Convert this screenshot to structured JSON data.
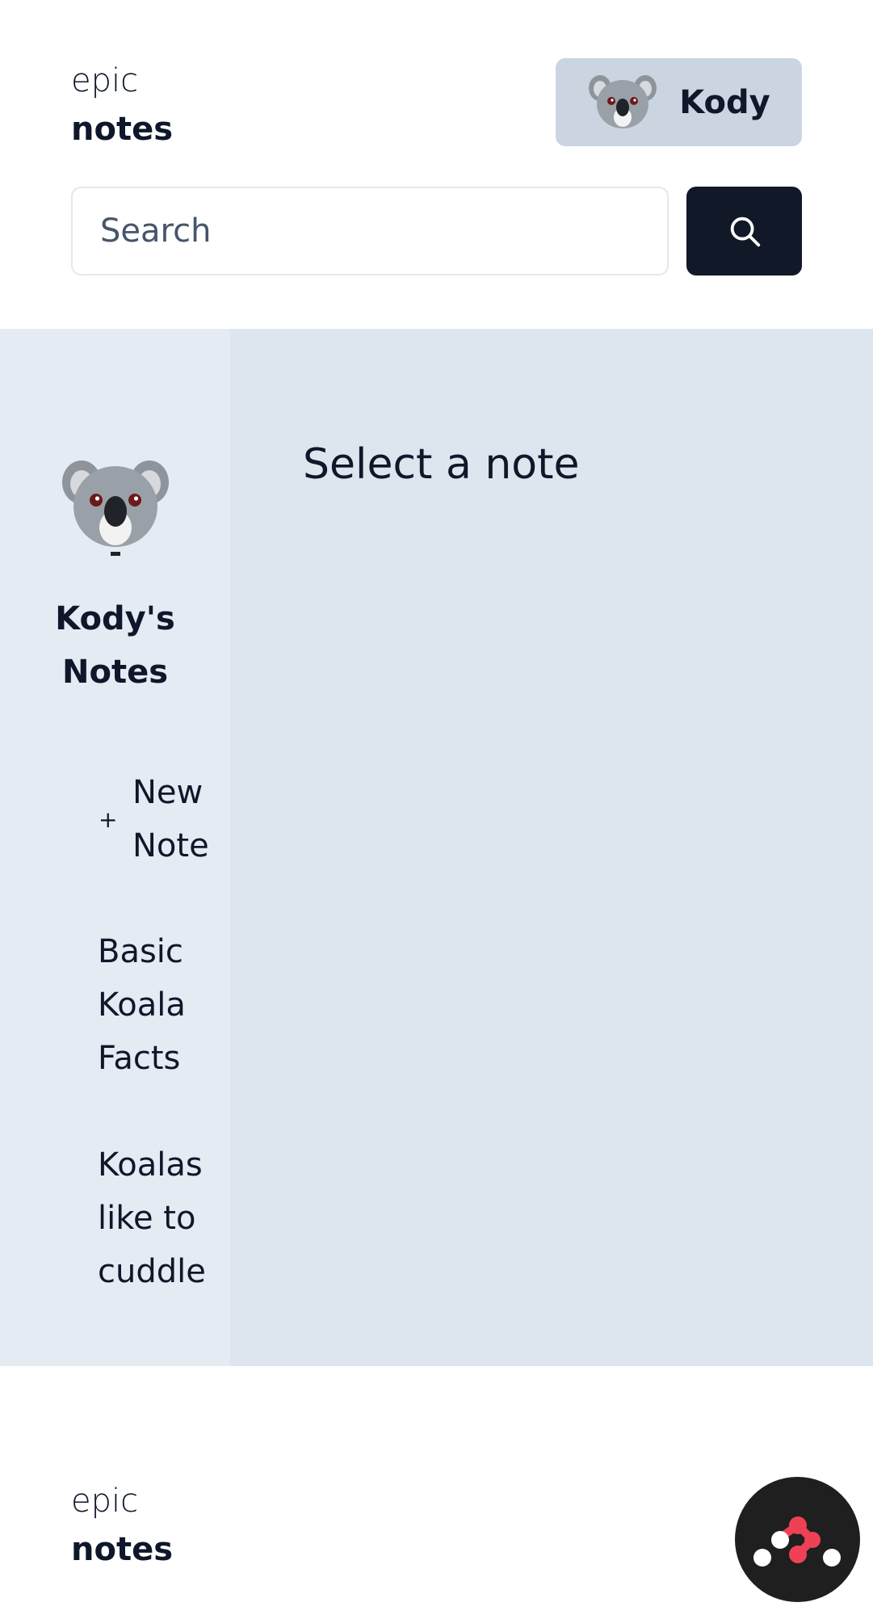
{
  "header": {
    "logo_line1": "epic",
    "logo_line2": "notes",
    "user_name": "Kody",
    "search_placeholder": "Search"
  },
  "sidebar": {
    "owner_title": "Kody's Notes",
    "new_note_label": "New Note",
    "notes": [
      "Basic Koala Facts",
      "Koalas like to cuddle"
    ]
  },
  "main": {
    "empty_state": "Select a note"
  },
  "footer": {
    "logo_line1": "epic",
    "logo_line2": "notes"
  },
  "colors": {
    "user_button_bg": "#cbd5e1",
    "search_button_bg": "#111827",
    "main_bg": "#dde5ef",
    "sidebar_bg": "#e5ebf3",
    "fab_accent": "#ef4155"
  },
  "icons": {
    "search": "search-icon",
    "avatar": "koala-avatar",
    "plus": "plus-icon",
    "fab": "remix-devtools-icon"
  }
}
